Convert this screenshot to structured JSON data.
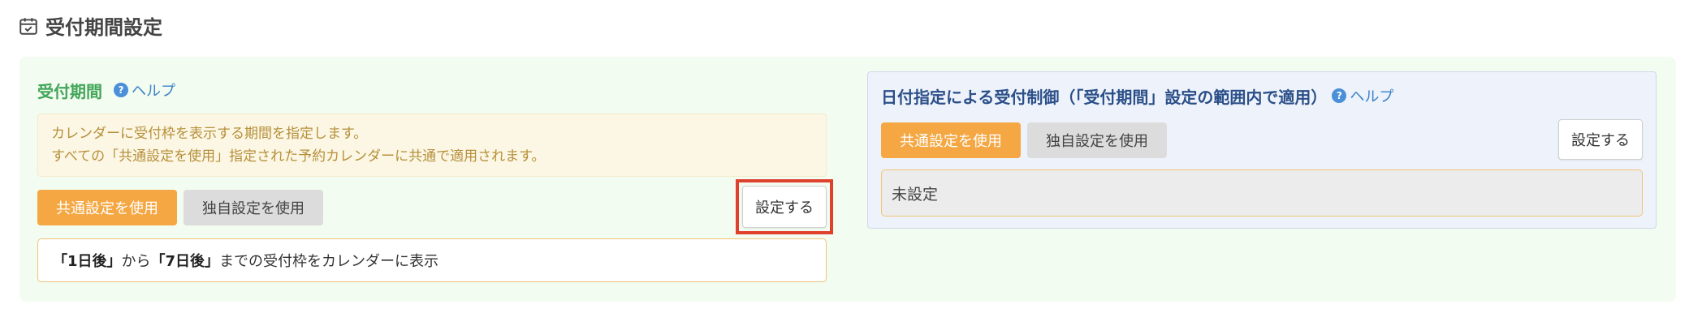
{
  "page": {
    "title": "受付期間設定",
    "icon": "calendar-check-icon"
  },
  "reception_period": {
    "title": "受付期間",
    "help_label": "ヘルプ",
    "notice_line1": "カレンダーに受付枠を表示する期間を指定します。",
    "notice_line2": "すべての「共通設定を使用」指定された予約カレンダーに共通で適用されます。",
    "common_button": "共通設定を使用",
    "custom_button": "独自設定を使用",
    "configure_button": "設定する",
    "result": {
      "start": "「1日後」",
      "from_text": "から",
      "end": "「7日後」",
      "suffix": "までの受付枠をカレンダーに表示"
    }
  },
  "date_restriction": {
    "title": "日付指定による受付制御（「受付期間」設定の範囲内で適用）",
    "help_label": "ヘルプ",
    "common_button": "共通設定を使用",
    "custom_button": "独自設定を使用",
    "configure_button": "設定する",
    "status": "未設定"
  },
  "colors": {
    "accent_orange": "#f4a742",
    "section_green": "#43a65a",
    "title_blue": "#2b4f88",
    "highlight_red": "#e0412d",
    "panel_bg": "#f3fcf0"
  }
}
